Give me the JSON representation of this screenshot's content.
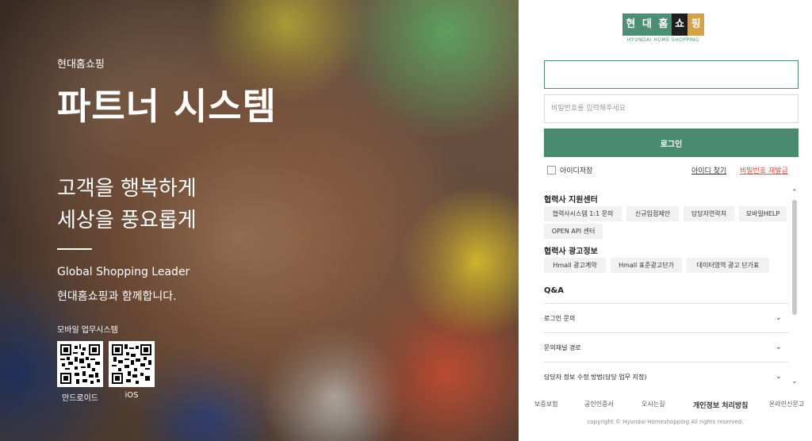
{
  "hero": {
    "brand_sub": "현대홈쇼핑",
    "title": "파트너 시스템",
    "slogan_line1": "고객을 행복하게",
    "slogan_line2": "세상을 풍요롭게",
    "leader": "Global Shopping Leader",
    "together": "현대홈쇼핑과 함께합니다.",
    "mobile_label": "모바일 업무시스템",
    "qr_android_label": "안드로이드",
    "qr_ios_label": "iOS"
  },
  "logo": {
    "chars": [
      "현",
      "대",
      "홈",
      "쇼",
      "핑"
    ],
    "sub": "HYUNDAI HOME SHOPPING"
  },
  "login": {
    "id_value": "",
    "id_placeholder": "",
    "pw_placeholder": "비밀번호를 입력해주세요",
    "button": "로그인",
    "save_id": "아이디저장",
    "find_id": "아이디 찾기",
    "reset_pw": "비밀번호 재발급"
  },
  "support": {
    "title": "협력사 지원센터",
    "chips": [
      "협력사시스템 1:1 문의",
      "신규입점제안",
      "담당자연락처",
      "모바일HELP",
      "OPEN API 센터"
    ]
  },
  "ads": {
    "title": "협력사 광고정보",
    "chips": [
      "Hmall 광고계약",
      "Hmall 표준광고단가",
      "데이터영역 광고 단가표"
    ]
  },
  "qa": {
    "title": "Q&A",
    "items": [
      "로그인 문의",
      "문의채널 경로",
      "담당자 정보 수정 방법(담당 업무 지정)"
    ]
  },
  "footer": {
    "links": [
      "보증보험",
      "공인인증서",
      "오시는길",
      "개인정보 처리방침",
      "온라인신문고"
    ],
    "copyright": "copyright © Hyundai Homeshopping All rights reserved."
  },
  "colors": {
    "brand_green": "#4a8a71",
    "reset_red": "#e0523b",
    "logo_dark": "#1f1f1f",
    "logo_gold": "#d5a24a"
  }
}
